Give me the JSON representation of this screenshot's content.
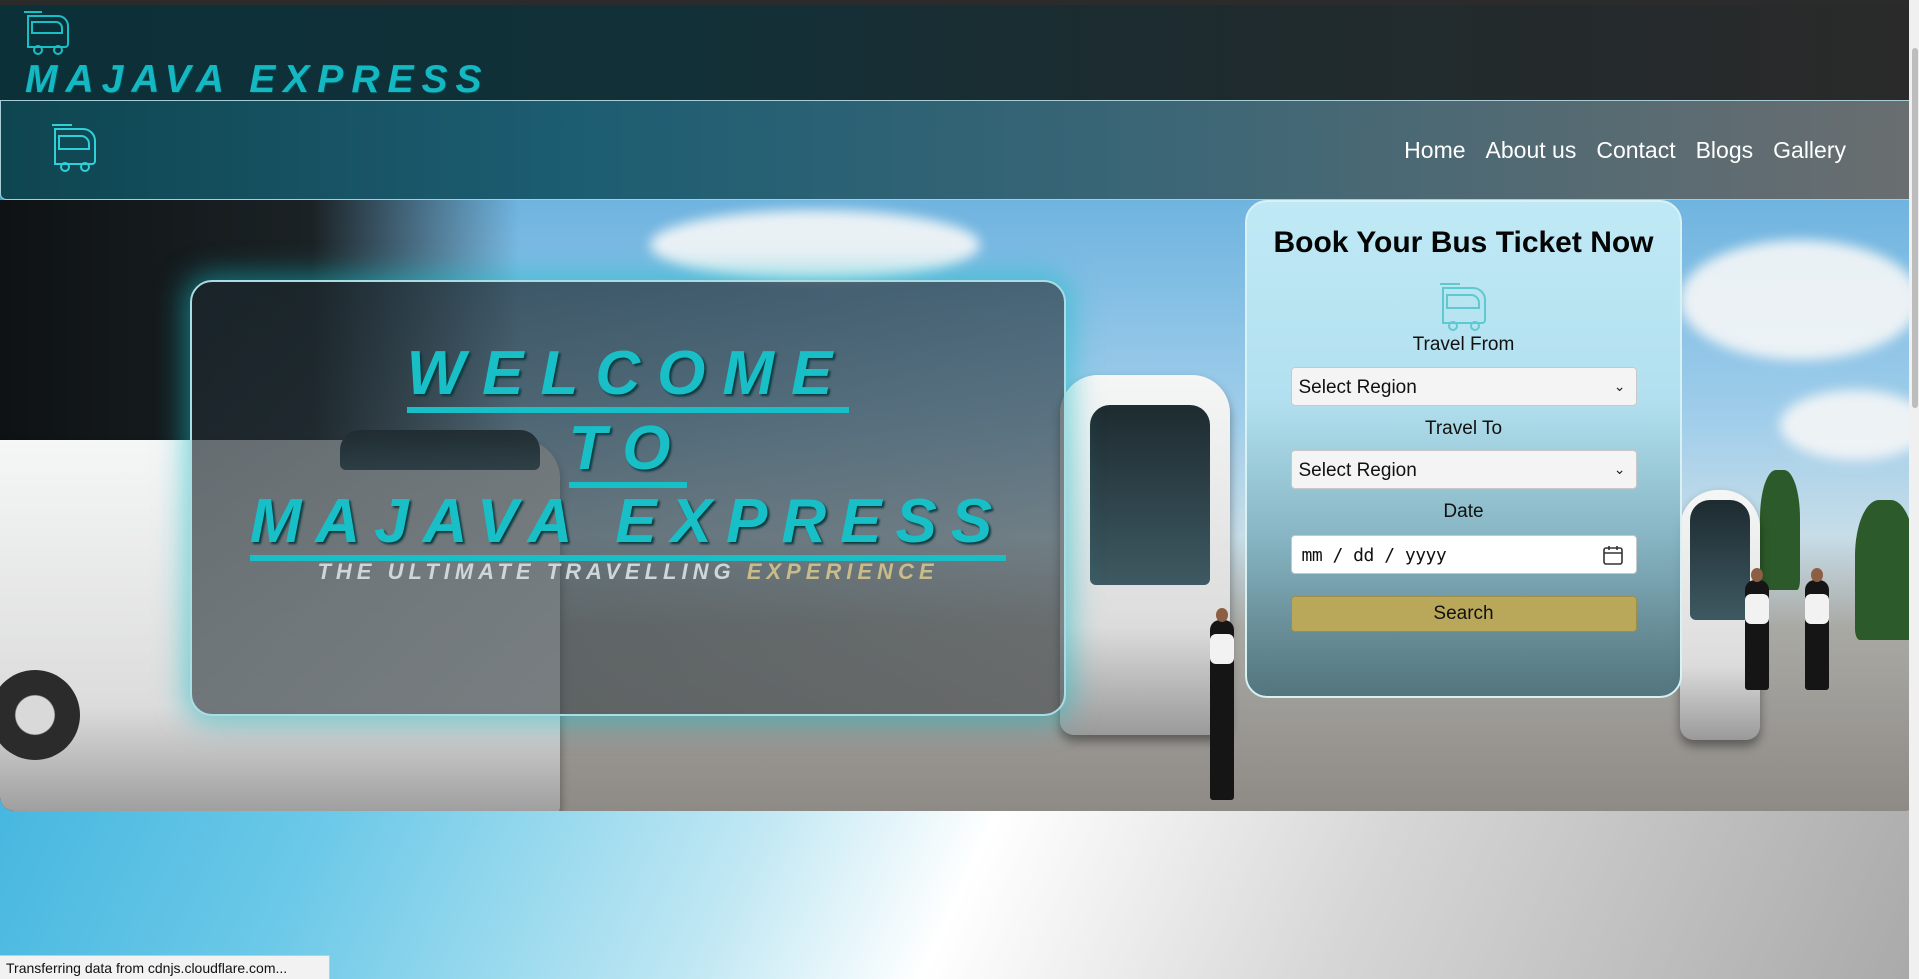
{
  "brand": {
    "title": "MAJAVA EXPRESS"
  },
  "nav": {
    "items": [
      "Home",
      "About us",
      "Contact",
      "Blogs",
      "Gallery"
    ]
  },
  "hero": {
    "line1": "WELCOME",
    "line2": "TO",
    "line3": "MAJAVA EXPRESS",
    "tagline_a": "THE ULTIMATE TRAVELLING ",
    "tagline_b": "EXPERIENCE"
  },
  "booking": {
    "title": "Book Your Bus Ticket Now",
    "from_label": "Travel From",
    "from_value": "Select Region",
    "to_label": "Travel To",
    "to_value": "Select Region",
    "date_label": "Date",
    "date_placeholder": "mm / dd / yyyy",
    "search_label": "Search"
  },
  "status": {
    "text": "Transferring data from cdnjs.cloudflare.com..."
  },
  "icons": {
    "brand": "bus-icon",
    "nav": "bus-icon",
    "booking": "bus-icon",
    "date": "calendar-icon",
    "select": "chevron-down-icon"
  },
  "colors": {
    "accent": "#19bfc7",
    "search_button": "#b9a85a",
    "tagline_highlight": "#c9bc8a"
  }
}
